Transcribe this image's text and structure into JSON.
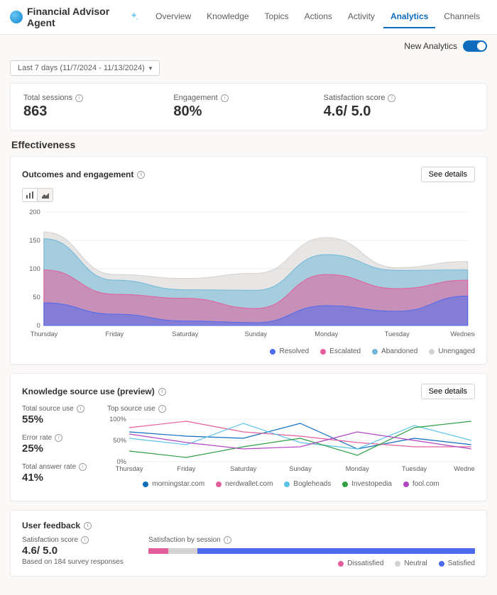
{
  "header": {
    "title": "Financial Advisor Agent",
    "tabs": [
      "Overview",
      "Knowledge",
      "Topics",
      "Actions",
      "Activity",
      "Analytics",
      "Channels"
    ],
    "active_tab": "Analytics"
  },
  "toolbar": {
    "toggle_label": "New Analytics"
  },
  "date_range": "Last 7 days (11/7/2024 - 11/13/2024)",
  "kpis": {
    "sessions_label": "Total sessions",
    "sessions_value": "863",
    "engagement_label": "Engagement",
    "engagement_value": "80%",
    "satisfaction_label": "Satisfaction score",
    "satisfaction_value": "4.6/ 5.0"
  },
  "effectiveness_title": "Effectiveness",
  "outcomes": {
    "title": "Outcomes and engagement",
    "see_details": "See details",
    "legend": [
      "Resolved",
      "Escalated",
      "Abandoned",
      "Unengaged"
    ]
  },
  "ks": {
    "title": "Knowledge source use (preview)",
    "see_details": "See details",
    "top_label": "Top source use",
    "stats": {
      "total_label": "Total source use",
      "total_value": "55%",
      "error_label": "Error rate",
      "error_value": "25%",
      "answer_label": "Total answer rate",
      "answer_value": "41%"
    },
    "legend": [
      "morningstar.com",
      "nerdwallet.com",
      "Bogleheads",
      "Investopedia",
      "fool.com"
    ]
  },
  "uf": {
    "title": "User feedback",
    "score_label": "Satisfaction score",
    "score_value": "4.6/ 5.0",
    "based_on": "Based on 184 survey responses",
    "by_session_label": "Satisfaction by session",
    "legend": [
      "Dissatisfied",
      "Neutral",
      "Satisfied"
    ]
  },
  "chart_data": [
    {
      "type": "area",
      "title": "Outcomes and engagement",
      "categories": [
        "Thursday",
        "Friday",
        "Saturday",
        "Sunday",
        "Monday",
        "Tuesday",
        "Wednesday"
      ],
      "ylim": [
        0,
        200
      ],
      "series": [
        {
          "name": "Resolved",
          "color": "#4f6bed",
          "values": [
            40,
            20,
            8,
            5,
            35,
            25,
            52
          ]
        },
        {
          "name": "Escalated",
          "color": "#e35f9b",
          "values": [
            58,
            35,
            40,
            25,
            55,
            40,
            28
          ]
        },
        {
          "name": "Abandoned",
          "color": "#6fb8d9",
          "values": [
            55,
            25,
            15,
            32,
            35,
            32,
            18
          ]
        },
        {
          "name": "Unengaged",
          "color": "#d4d2d0",
          "values": [
            12,
            10,
            20,
            30,
            30,
            5,
            15
          ]
        }
      ]
    },
    {
      "type": "line",
      "title": "Top source use",
      "categories": [
        "Thursday",
        "Friday",
        "Saturday",
        "Sunday",
        "Monday",
        "Tuesday",
        "Wednesday"
      ],
      "ylabel": "%",
      "ylim": [
        0,
        100
      ],
      "series": [
        {
          "name": "morningstar.com",
          "color": "#0f6cbd",
          "values": [
            70,
            60,
            55,
            90,
            30,
            55,
            40
          ]
        },
        {
          "name": "nerdwallet.com",
          "color": "#e35f9b",
          "values": [
            80,
            95,
            70,
            60,
            45,
            35,
            35
          ]
        },
        {
          "name": "Bogleheads",
          "color": "#5cc3e8",
          "values": [
            55,
            40,
            90,
            45,
            30,
            85,
            50
          ]
        },
        {
          "name": "Investopedia",
          "color": "#2f9e44",
          "values": [
            25,
            10,
            35,
            55,
            15,
            80,
            95
          ]
        },
        {
          "name": "fool.com",
          "color": "#b146c2",
          "values": [
            65,
            45,
            30,
            35,
            70,
            50,
            30
          ]
        }
      ]
    },
    {
      "type": "bar",
      "title": "Satisfaction by session",
      "series": [
        {
          "name": "Dissatisfied",
          "color": "#e35f9b",
          "value": 6
        },
        {
          "name": "Neutral",
          "color": "#d4d2d0",
          "value": 9
        },
        {
          "name": "Satisfied",
          "color": "#4f6bed",
          "value": 85
        }
      ]
    }
  ]
}
